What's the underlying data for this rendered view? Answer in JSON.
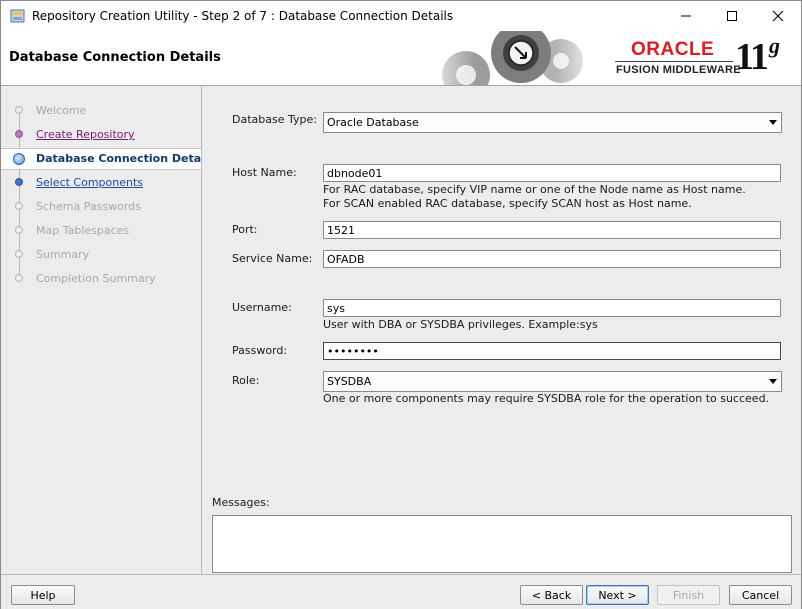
{
  "window": {
    "title": "Repository Creation Utility - Step 2 of 7 : Database Connection Details",
    "controls": [
      "minimize",
      "maximize",
      "close"
    ]
  },
  "banner": {
    "title": "Database Connection Details",
    "brand": "ORACLE",
    "product": "FUSION MIDDLEWARE",
    "version": "11",
    "version_suffix": "g"
  },
  "steps": [
    {
      "label": "Welcome",
      "state": "disabled"
    },
    {
      "label": "Create Repository",
      "state": "visited"
    },
    {
      "label": "Database Connection Details",
      "state": "current"
    },
    {
      "label": "Select Components",
      "state": "link"
    },
    {
      "label": "Schema Passwords",
      "state": "disabled"
    },
    {
      "label": "Map Tablespaces",
      "state": "disabled"
    },
    {
      "label": "Summary",
      "state": "disabled"
    },
    {
      "label": "Completion Summary",
      "state": "disabled"
    }
  ],
  "form": {
    "db_type": {
      "label": "Database Type:",
      "value": "Oracle Database"
    },
    "host": {
      "label": "Host Name:",
      "value": "dbnode01",
      "hint1": "For RAC database, specify VIP name or one of the Node name as Host name.",
      "hint2": "For SCAN enabled RAC database, specify SCAN host as Host name."
    },
    "port": {
      "label": "Port:",
      "value": "1521"
    },
    "service": {
      "label": "Service Name:",
      "value": "OFADB"
    },
    "username": {
      "label": "Username:",
      "value": "sys",
      "hint": "User with DBA or SYSDBA privileges. Example:sys"
    },
    "password": {
      "label": "Password:",
      "value": "••••••••"
    },
    "role": {
      "label": "Role:",
      "value": "SYSDBA",
      "hint": "One or more components may require SYSDBA role for the operation to succeed."
    }
  },
  "messages": {
    "label": "Messages:"
  },
  "footer": {
    "help": "Help",
    "back": "< Back",
    "next": "Next >",
    "finish": "Finish",
    "cancel": "Cancel"
  },
  "colors": {
    "oracle_red": "#e01b22",
    "link_blue": "#1f4aa8",
    "visited_purple": "#7a1b75",
    "current_text": "#123a6a"
  }
}
